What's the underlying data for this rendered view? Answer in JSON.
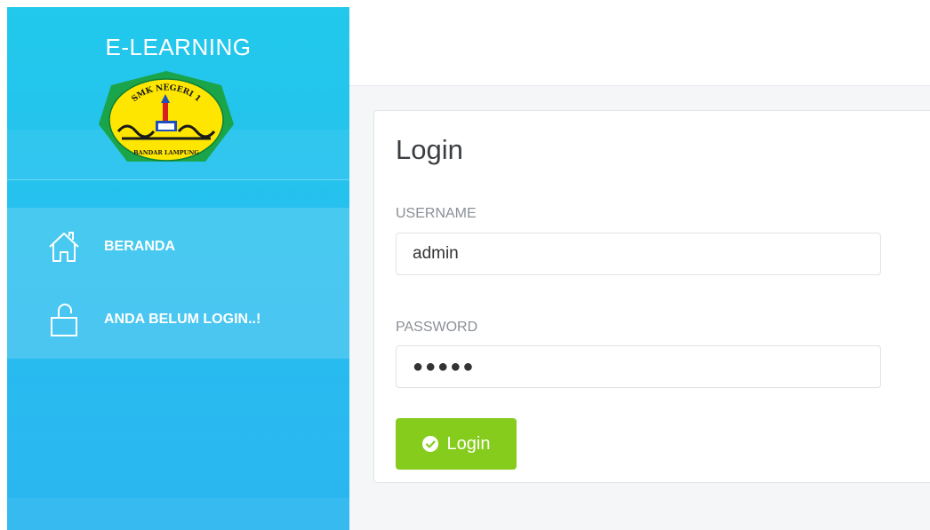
{
  "sidebar": {
    "title": "E-LEARNING",
    "logo": {
      "top_text": "SMK NEGERI 1",
      "bottom_text": "BANDAR LAMPUNG",
      "colors": {
        "outer": "#1aa54a",
        "inner": "#ffe600"
      }
    },
    "menu": [
      {
        "label": "BERANDA",
        "icon": "home-icon"
      },
      {
        "label": "ANDA BELUM LOGIN..!",
        "icon": "unlock-icon"
      }
    ]
  },
  "login": {
    "title": "Login",
    "username": {
      "label": "USERNAME",
      "value": "admin"
    },
    "password": {
      "label": "PASSWORD",
      "value": "●●●●●"
    },
    "button": {
      "label": "Login",
      "icon": "check-circle-icon"
    }
  },
  "colors": {
    "sidebar_accent": "#22c9ec",
    "button_green": "#86cc1c",
    "content_bg": "#f4f6f8"
  }
}
